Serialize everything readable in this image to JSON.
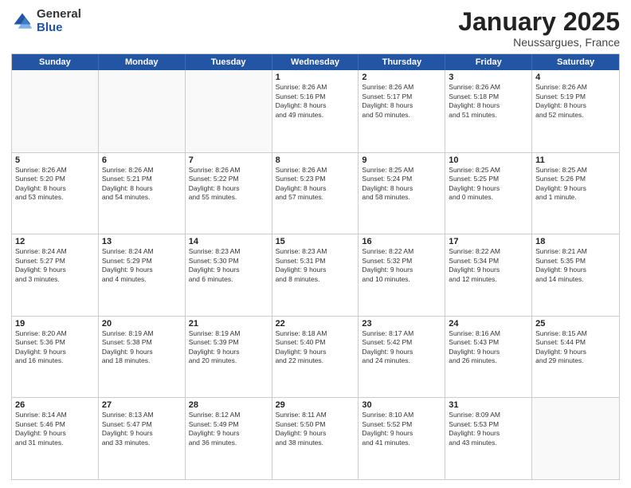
{
  "logo": {
    "general": "General",
    "blue": "Blue"
  },
  "title": "January 2025",
  "location": "Neussargues, France",
  "header_days": [
    "Sunday",
    "Monday",
    "Tuesday",
    "Wednesday",
    "Thursday",
    "Friday",
    "Saturday"
  ],
  "weeks": [
    [
      {
        "day": "",
        "text": ""
      },
      {
        "day": "",
        "text": ""
      },
      {
        "day": "",
        "text": ""
      },
      {
        "day": "1",
        "text": "Sunrise: 8:26 AM\nSunset: 5:16 PM\nDaylight: 8 hours\nand 49 minutes."
      },
      {
        "day": "2",
        "text": "Sunrise: 8:26 AM\nSunset: 5:17 PM\nDaylight: 8 hours\nand 50 minutes."
      },
      {
        "day": "3",
        "text": "Sunrise: 8:26 AM\nSunset: 5:18 PM\nDaylight: 8 hours\nand 51 minutes."
      },
      {
        "day": "4",
        "text": "Sunrise: 8:26 AM\nSunset: 5:19 PM\nDaylight: 8 hours\nand 52 minutes."
      }
    ],
    [
      {
        "day": "5",
        "text": "Sunrise: 8:26 AM\nSunset: 5:20 PM\nDaylight: 8 hours\nand 53 minutes."
      },
      {
        "day": "6",
        "text": "Sunrise: 8:26 AM\nSunset: 5:21 PM\nDaylight: 8 hours\nand 54 minutes."
      },
      {
        "day": "7",
        "text": "Sunrise: 8:26 AM\nSunset: 5:22 PM\nDaylight: 8 hours\nand 55 minutes."
      },
      {
        "day": "8",
        "text": "Sunrise: 8:26 AM\nSunset: 5:23 PM\nDaylight: 8 hours\nand 57 minutes."
      },
      {
        "day": "9",
        "text": "Sunrise: 8:25 AM\nSunset: 5:24 PM\nDaylight: 8 hours\nand 58 minutes."
      },
      {
        "day": "10",
        "text": "Sunrise: 8:25 AM\nSunset: 5:25 PM\nDaylight: 9 hours\nand 0 minutes."
      },
      {
        "day": "11",
        "text": "Sunrise: 8:25 AM\nSunset: 5:26 PM\nDaylight: 9 hours\nand 1 minute."
      }
    ],
    [
      {
        "day": "12",
        "text": "Sunrise: 8:24 AM\nSunset: 5:27 PM\nDaylight: 9 hours\nand 3 minutes."
      },
      {
        "day": "13",
        "text": "Sunrise: 8:24 AM\nSunset: 5:29 PM\nDaylight: 9 hours\nand 4 minutes."
      },
      {
        "day": "14",
        "text": "Sunrise: 8:23 AM\nSunset: 5:30 PM\nDaylight: 9 hours\nand 6 minutes."
      },
      {
        "day": "15",
        "text": "Sunrise: 8:23 AM\nSunset: 5:31 PM\nDaylight: 9 hours\nand 8 minutes."
      },
      {
        "day": "16",
        "text": "Sunrise: 8:22 AM\nSunset: 5:32 PM\nDaylight: 9 hours\nand 10 minutes."
      },
      {
        "day": "17",
        "text": "Sunrise: 8:22 AM\nSunset: 5:34 PM\nDaylight: 9 hours\nand 12 minutes."
      },
      {
        "day": "18",
        "text": "Sunrise: 8:21 AM\nSunset: 5:35 PM\nDaylight: 9 hours\nand 14 minutes."
      }
    ],
    [
      {
        "day": "19",
        "text": "Sunrise: 8:20 AM\nSunset: 5:36 PM\nDaylight: 9 hours\nand 16 minutes."
      },
      {
        "day": "20",
        "text": "Sunrise: 8:19 AM\nSunset: 5:38 PM\nDaylight: 9 hours\nand 18 minutes."
      },
      {
        "day": "21",
        "text": "Sunrise: 8:19 AM\nSunset: 5:39 PM\nDaylight: 9 hours\nand 20 minutes."
      },
      {
        "day": "22",
        "text": "Sunrise: 8:18 AM\nSunset: 5:40 PM\nDaylight: 9 hours\nand 22 minutes."
      },
      {
        "day": "23",
        "text": "Sunrise: 8:17 AM\nSunset: 5:42 PM\nDaylight: 9 hours\nand 24 minutes."
      },
      {
        "day": "24",
        "text": "Sunrise: 8:16 AM\nSunset: 5:43 PM\nDaylight: 9 hours\nand 26 minutes."
      },
      {
        "day": "25",
        "text": "Sunrise: 8:15 AM\nSunset: 5:44 PM\nDaylight: 9 hours\nand 29 minutes."
      }
    ],
    [
      {
        "day": "26",
        "text": "Sunrise: 8:14 AM\nSunset: 5:46 PM\nDaylight: 9 hours\nand 31 minutes."
      },
      {
        "day": "27",
        "text": "Sunrise: 8:13 AM\nSunset: 5:47 PM\nDaylight: 9 hours\nand 33 minutes."
      },
      {
        "day": "28",
        "text": "Sunrise: 8:12 AM\nSunset: 5:49 PM\nDaylight: 9 hours\nand 36 minutes."
      },
      {
        "day": "29",
        "text": "Sunrise: 8:11 AM\nSunset: 5:50 PM\nDaylight: 9 hours\nand 38 minutes."
      },
      {
        "day": "30",
        "text": "Sunrise: 8:10 AM\nSunset: 5:52 PM\nDaylight: 9 hours\nand 41 minutes."
      },
      {
        "day": "31",
        "text": "Sunrise: 8:09 AM\nSunset: 5:53 PM\nDaylight: 9 hours\nand 43 minutes."
      },
      {
        "day": "",
        "text": ""
      }
    ]
  ]
}
